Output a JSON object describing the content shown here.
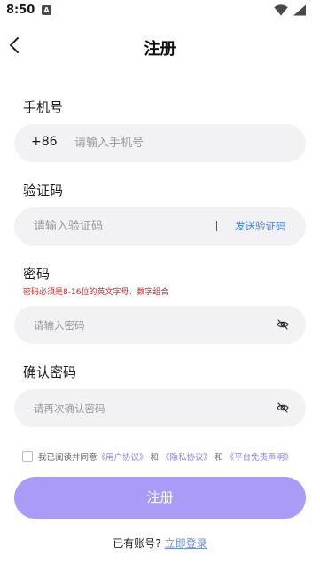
{
  "status_bar": {
    "time": "8:50",
    "notification_badge": "A",
    "icons": [
      "wifi-icon",
      "battery-icon"
    ]
  },
  "header": {
    "title": "注册",
    "back_icon": "chevron-left-icon"
  },
  "form": {
    "phone": {
      "label": "手机号",
      "prefix": "+86",
      "placeholder": "请输入手机号",
      "value": ""
    },
    "code": {
      "label": "验证码",
      "placeholder": "请输入验证码",
      "value": "",
      "send_label": "发送验证码"
    },
    "password": {
      "label": "密码",
      "hint": "密码必须是8-16位的英文字母、数字组合",
      "placeholder": "请输入密码",
      "value": "",
      "toggle_icon": "eye-off-icon"
    },
    "confirm_password": {
      "label": "确认密码",
      "placeholder": "请再次确认密码",
      "value": "",
      "toggle_icon": "eye-off-icon"
    }
  },
  "agreement": {
    "checked": false,
    "prefix": "我已阅读并同意",
    "user_agreement": "《用户协议》",
    "and1": "和",
    "privacy_agreement": "《隐私协议》",
    "and2": "和",
    "disclaimer": "《平台免责声明》"
  },
  "submit": {
    "label": "注册"
  },
  "login_prompt": {
    "text": "已有账号?",
    "link": "立即登录"
  },
  "colors": {
    "accent": "#a99bf7",
    "link_blue": "#3b82f6",
    "link_purple": "#8a7df0",
    "hint_red": "#d62222",
    "field_bg": "#f2f2f4"
  }
}
